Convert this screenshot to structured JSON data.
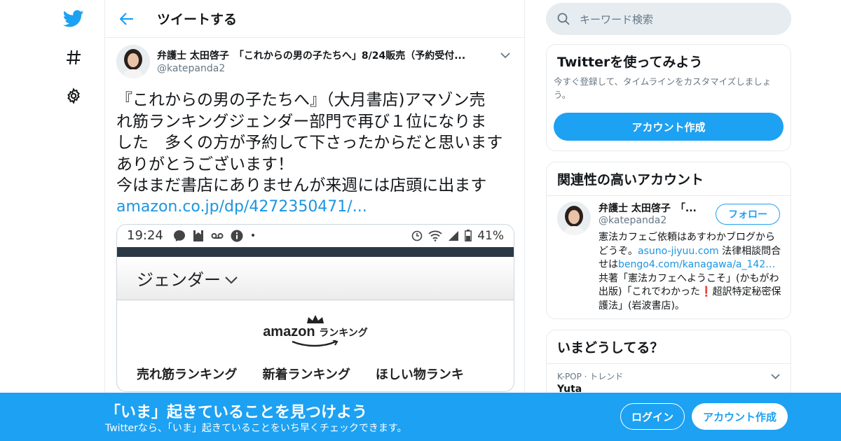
{
  "colors": {
    "brand": "#1da1f2",
    "link": "#1b95e0",
    "muted": "#657786",
    "border": "#e6ecf0"
  },
  "nav": {
    "icons": [
      "twitter-bird-icon",
      "hashtag-icon",
      "gear-icon"
    ]
  },
  "header": {
    "title": "ツイートする",
    "back_icon": "arrow-left-icon"
  },
  "tweet": {
    "author_name": "弁護士 太田啓子　「これからの男の子たちへ」8/24販売（予約受付...",
    "author_handle": "@katepanda2",
    "text": "『これからの男の子たちへ』（大月書店)アマゾン売\nれ筋ランキングジェンダー部門で再び１位になりま\nした　多くの方が予約して下さったからだと思います\nありがとうございます！\n今はまだ書店にありませんが来週には店頭に出ます",
    "link": "amazon.co.jp/dp/4272350471/...",
    "media": {
      "status_time": "19:24",
      "battery": "41%",
      "category": "ジェンダー",
      "amazon_logo": "amazon",
      "amazon_sub": "ランキング",
      "cut_text": "売れ筋ランキング　　新着ランキング　　ほしい物ランキ"
    }
  },
  "search": {
    "placeholder": "キーワード検索"
  },
  "try_card": {
    "title": "Twitterを使ってみよう",
    "desc": "今すぐ登録して、タイムラインをカスタマイズしましょう。",
    "button": "アカウント作成"
  },
  "related": {
    "title": "関連性の高いアカウント",
    "name": "弁護士 太田啓子　「...",
    "handle": "@katepanda2",
    "follow": "フォロー",
    "bio_1": "憲法カフェご依頼はあすわかブログからどうぞ。",
    "bio_link1": "asuno-jiyuu.com",
    "bio_2": " 法律相談問合せは",
    "bio_link2": "bengo4.com/kanagawa/a_142…",
    "bio_3": " 共著「憲法カフェへようこそ」(かもがわ出版)「これでわかった",
    "bio_mark": "❗",
    "bio_4": "超訳特定秘密保護法」(岩波書店)。"
  },
  "trends": {
    "title": "いまどうしてる？",
    "meta": "K-POP · トレンド",
    "name": "Yuta"
  },
  "banner": {
    "title": "「いま」起きていることを見つけよう",
    "subtitle": "Twitterなら、「いま」起きていることをいち早くチェックできます。",
    "login": "ログイン",
    "signup": "アカウント作成"
  }
}
